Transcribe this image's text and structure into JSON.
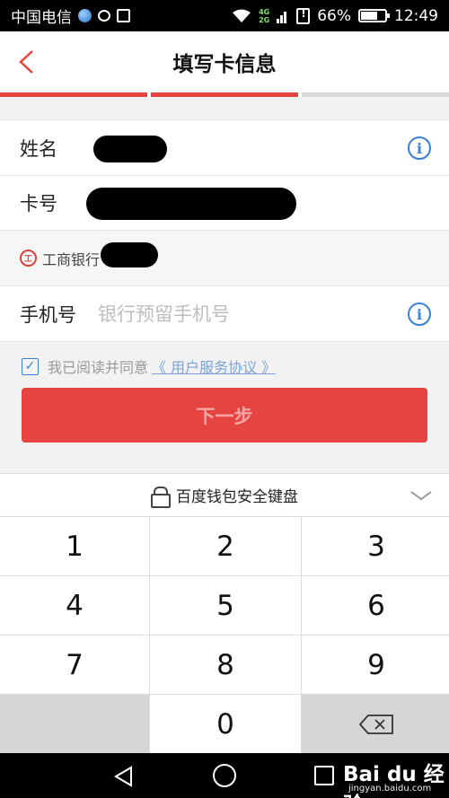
{
  "status_bar": {
    "carrier": "中国电信",
    "net_4g": "4G",
    "net_2g": "2G",
    "battery": "66%",
    "time": "12:49"
  },
  "header": {
    "title": "填写卡信息",
    "progress_colors": [
      "#e64441",
      "#e64441",
      "#d9d9d9"
    ]
  },
  "form": {
    "name_label": "姓名",
    "card_label": "卡号",
    "bank_name": "工商银行",
    "bank_logo": "工",
    "phone_label": "手机号",
    "phone_placeholder": "银行预留手机号",
    "info_icon": "i"
  },
  "agreement": {
    "checked": true,
    "text": "我已阅读并同意",
    "link": "《 用户服务协议 》"
  },
  "next_button": "下一步",
  "keyboard": {
    "title": "百度钱包安全键盘",
    "keys": [
      "1",
      "2",
      "3",
      "4",
      "5",
      "6",
      "7",
      "8",
      "9",
      "0"
    ]
  },
  "watermark": {
    "main": "Bai du 经验",
    "sub": "jingyan.baidu.com"
  },
  "colors": {
    "accent": "#e64441",
    "link_blue": "#3b7fd0"
  }
}
